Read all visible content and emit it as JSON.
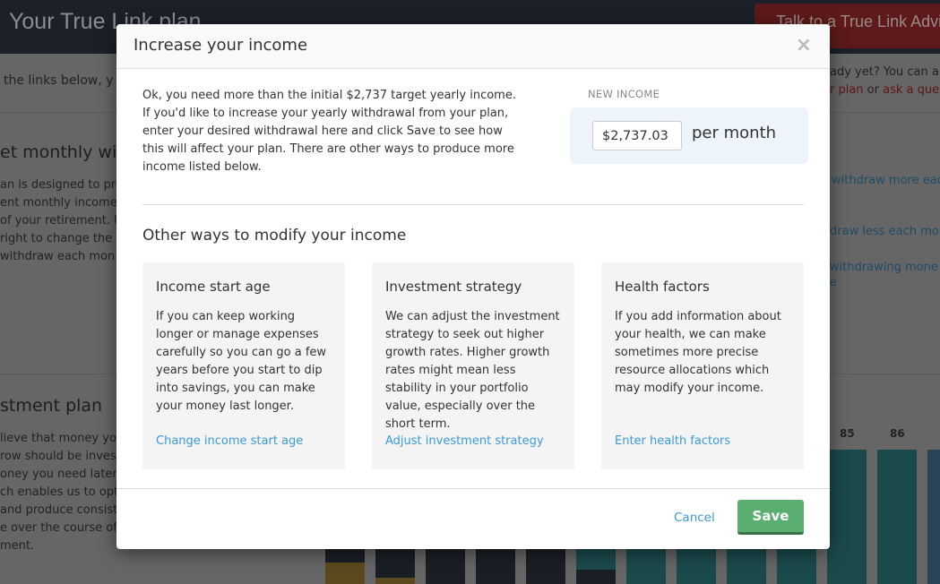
{
  "background": {
    "header_title": "Your True Link plan",
    "header_button": "Talk to a True Link Advisor",
    "intro_left": "the links below, y",
    "intro_right": "ady yet? You can als",
    "intro_right_link1": "r plan",
    "intro_right_or": " or ",
    "intro_right_link2": "ask a ques",
    "section1_title": "et monthly with",
    "section1_lines": [
      "an is designed to pro",
      "ent monthly income",
      "of your retirement. U",
      "right to change the a",
      "withdraw each mon"
    ],
    "section1_links": [
      "withdraw more eac",
      "draw less each mon",
      "withdrawing mone",
      "e"
    ],
    "section2_title": "stment plan",
    "section2_lines": [
      "lieve that money you",
      "row should be investe",
      "oney you need later",
      "ch enables us to opt",
      "and produce consist",
      "e over the course of y",
      "ment."
    ],
    "chart_labels": [
      "85",
      "86"
    ]
  },
  "modal": {
    "title": "Increase your income",
    "close": "×",
    "intro": "Ok, you need more than the initial $2,737 target yearly income. If you'd like to increase your yearly withdrawal from your plan, enter your desired withdrawal here and click Save to see how this will affect your plan. There are other ways to produce more income listed below.",
    "new_income_label": "NEW INCOME",
    "new_income_value": "$2,737.03",
    "per_month": "per month",
    "other_heading": "Other ways to modify your income",
    "cards": [
      {
        "title": "Income start age",
        "body": "If you can keep working longer or manage expenses carefully so you can go a few years before you start to dip into savings, you can make your money last longer.",
        "link": "Change income start age"
      },
      {
        "title": "Investment strategy",
        "body": "We can adjust the investment strategy to seek out higher growth rates. Higher growth rates might mean less stability in your portfolio value, especially over the short term.",
        "link": "Adjust investment strategy"
      },
      {
        "title": "Health factors",
        "body": "If you add information about your health, we can make sometimes more precise resource allocations which may modify your income.",
        "link": "Enter health factors"
      }
    ],
    "cancel": "Cancel",
    "save": "Save"
  },
  "colors": {
    "accent": "#3a9ad9",
    "save": "#5aae70"
  }
}
